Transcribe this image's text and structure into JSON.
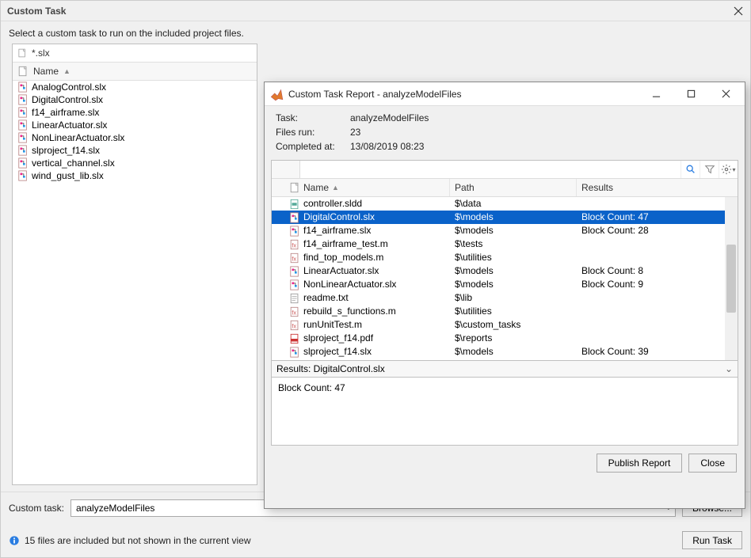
{
  "window": {
    "title": "Custom Task",
    "instruction": "Select a custom task to run on the included project files."
  },
  "filter": {
    "pattern": "*.slx",
    "header": "Name"
  },
  "files": [
    {
      "name": "AnalogControl.slx",
      "icon": "slx"
    },
    {
      "name": "DigitalControl.slx",
      "icon": "slx"
    },
    {
      "name": "f14_airframe.slx",
      "icon": "slx"
    },
    {
      "name": "LinearActuator.slx",
      "icon": "slx"
    },
    {
      "name": "NonLinearActuator.slx",
      "icon": "slx"
    },
    {
      "name": "slproject_f14.slx",
      "icon": "slx"
    },
    {
      "name": "vertical_channel.slx",
      "icon": "slx"
    },
    {
      "name": "wind_gust_lib.slx",
      "icon": "slx"
    }
  ],
  "bottom": {
    "label": "Custom task:",
    "value": "analyzeModelFiles",
    "browse": "Browse...",
    "status": "15 files are included but not shown in the current view",
    "run": "Run Task"
  },
  "report": {
    "title": "Custom Task Report - analyzeModelFiles",
    "meta": {
      "task_label": "Task:",
      "task_value": "analyzeModelFiles",
      "files_label": "Files run:",
      "files_value": "23",
      "completed_label": "Completed at:",
      "completed_value": "13/08/2019 08:23"
    },
    "columns": {
      "name": "Name",
      "path": "Path",
      "results": "Results"
    },
    "selected_index": 1,
    "rows": [
      {
        "name": "controller.sldd",
        "icon": "sldd",
        "path": "$\\data",
        "results": ""
      },
      {
        "name": "DigitalControl.slx",
        "icon": "slx",
        "path": "$\\models",
        "results": "Block Count: 47"
      },
      {
        "name": "f14_airframe.slx",
        "icon": "slx",
        "path": "$\\models",
        "results": "Block Count: 28"
      },
      {
        "name": "f14_airframe_test.m",
        "icon": "m",
        "path": "$\\tests",
        "results": ""
      },
      {
        "name": "find_top_models.m",
        "icon": "m",
        "path": "$\\utilities",
        "results": ""
      },
      {
        "name": "LinearActuator.slx",
        "icon": "slx",
        "path": "$\\models",
        "results": "Block Count: 8"
      },
      {
        "name": "NonLinearActuator.slx",
        "icon": "slx",
        "path": "$\\models",
        "results": "Block Count: 9"
      },
      {
        "name": "readme.txt",
        "icon": "txt",
        "path": "$\\lib",
        "results": ""
      },
      {
        "name": "rebuild_s_functions.m",
        "icon": "m",
        "path": "$\\utilities",
        "results": ""
      },
      {
        "name": "runUnitTest.m",
        "icon": "m",
        "path": "$\\custom_tasks",
        "results": ""
      },
      {
        "name": "slproject_f14.pdf",
        "icon": "pdf",
        "path": "$\\reports",
        "results": ""
      },
      {
        "name": "slproject_f14.slx",
        "icon": "slx",
        "path": "$\\models",
        "results": "Block Count: 39"
      }
    ],
    "results_header": "Results: DigitalControl.slx",
    "results_body": "Block Count: 47",
    "buttons": {
      "publish": "Publish Report",
      "close": "Close"
    }
  }
}
